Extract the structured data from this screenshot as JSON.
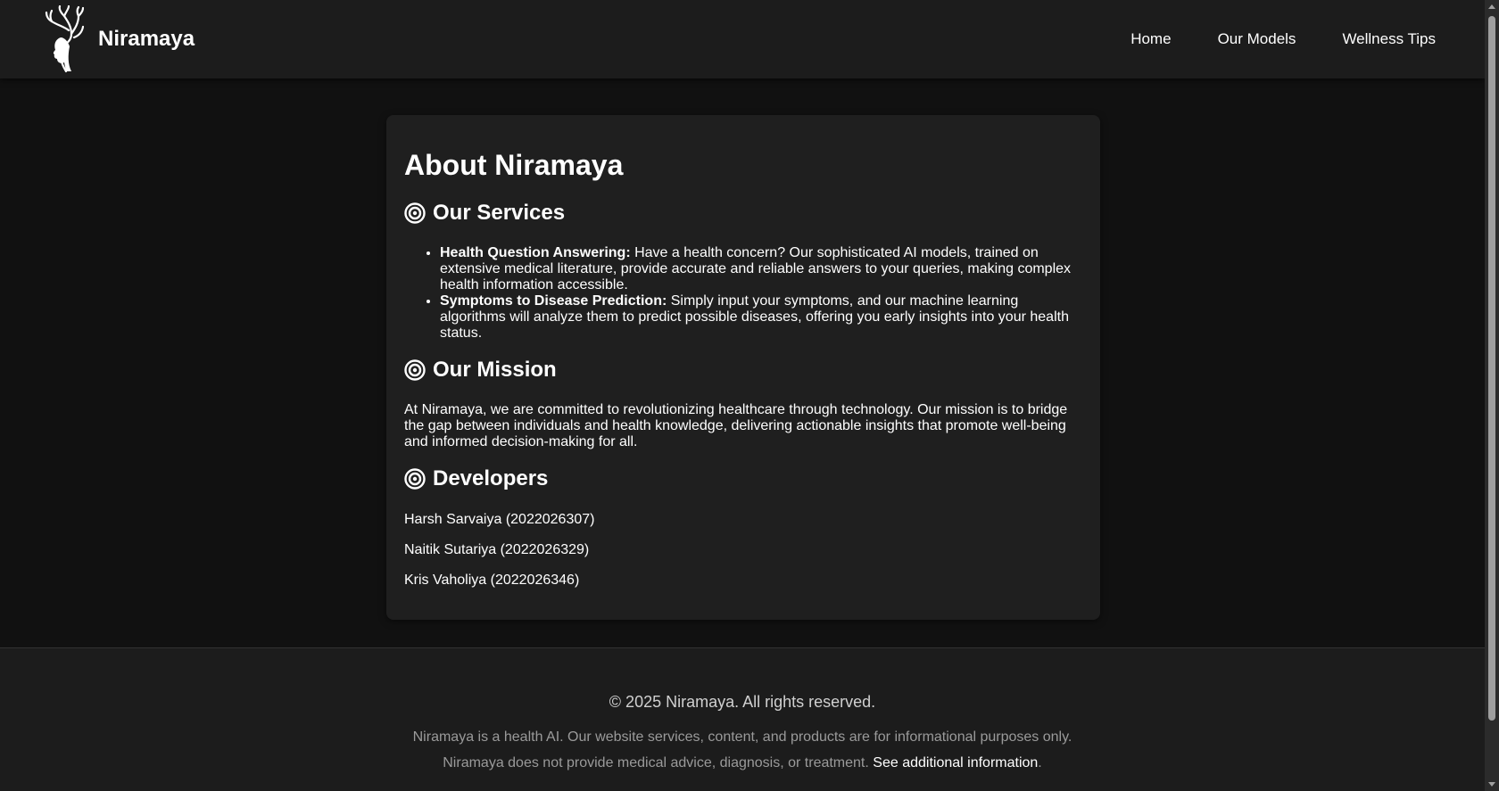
{
  "header": {
    "brand_name": "Niramaya",
    "nav": [
      "Home",
      "Our Models",
      "Wellness Tips"
    ]
  },
  "about": {
    "title": "About Niramaya",
    "services": {
      "heading": "Our Services",
      "items": [
        {
          "label": "Health Question Answering:",
          "text": " Have a health concern? Our sophisticated AI models, trained on extensive medical literature, provide accurate and reliable answers to your queries, making complex health information accessible."
        },
        {
          "label": "Symptoms to Disease Prediction:",
          "text": " Simply input your symptoms, and our machine learning algorithms will analyze them to predict possible diseases, offering you early insights into your health status."
        }
      ]
    },
    "mission": {
      "heading": "Our Mission",
      "text": "At Niramaya, we are committed to revolutionizing healthcare through technology. Our mission is to bridge the gap between individuals and health knowledge, delivering actionable insights that promote well-being and informed decision-making for all."
    },
    "developers": {
      "heading": "Developers",
      "list": [
        "Harsh Sarvaiya (2022026307)",
        "Naitik Sutariya (2022026329)",
        "Kris Vaholiya (2022026346)"
      ]
    }
  },
  "footer": {
    "copyright": "© 2025 Niramaya. All rights reserved.",
    "disclaimer_line1": "Niramaya is a health AI. Our website services, content, and products are for informational purposes only.",
    "disclaimer_line2": "Niramaya does not provide medical advice, diagnosis, or treatment.",
    "link_text": "See additional information",
    "link_suffix": "."
  },
  "icons": {
    "logo": "tree-face-logo-icon",
    "section": "target-icon"
  },
  "colors": {
    "page_bg": "#111111",
    "header_bg": "#1c1c1c",
    "card_bg": "#1f1f1f",
    "text": "#ffffff",
    "muted": "#9a9a9a"
  }
}
